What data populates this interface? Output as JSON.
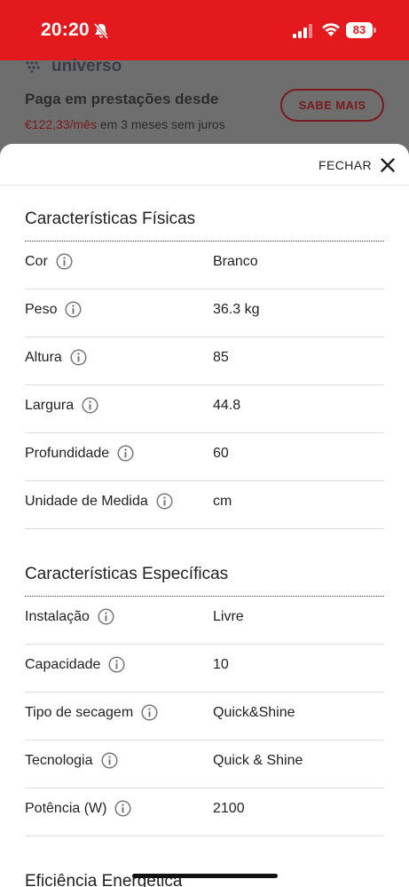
{
  "status_bar": {
    "time": "20:20",
    "battery": "83",
    "icons": [
      "bell-slash-icon",
      "cellular-signal-icon",
      "wifi-icon",
      "battery-icon"
    ]
  },
  "background_page": {
    "logo_text": "universo",
    "heading": "Paga em prestações desde",
    "price": "€122,33/mês",
    "price_suffix": " em 3 meses sem juros",
    "button_label": "SABE MAIS"
  },
  "sheet": {
    "close_label": "FECHAR",
    "sections": [
      {
        "title": "Características Físicas",
        "rows": [
          {
            "label": "Cor",
            "value": "Branco"
          },
          {
            "label": "Peso",
            "value": "36.3 kg"
          },
          {
            "label": "Altura",
            "value": "85"
          },
          {
            "label": "Largura",
            "value": "44.8"
          },
          {
            "label": "Profundidade",
            "value": "60"
          },
          {
            "label": "Unidade de Medida",
            "value": "cm"
          }
        ]
      },
      {
        "title": "Características Específicas",
        "rows": [
          {
            "label": "Instalação",
            "value": "Livre"
          },
          {
            "label": "Capacidade",
            "value": "10"
          },
          {
            "label": "Tipo de secagem",
            "value": "Quick&Shine"
          },
          {
            "label": "Tecnologia",
            "value": "Quick & Shine"
          },
          {
            "label": "Potência (W)",
            "value": "2100"
          }
        ]
      },
      {
        "title": "Eficiência Energética",
        "rows": []
      }
    ]
  },
  "colors": {
    "status_bar": "#e3191e",
    "overlay": "#6e6e6e",
    "text": "#222222"
  }
}
